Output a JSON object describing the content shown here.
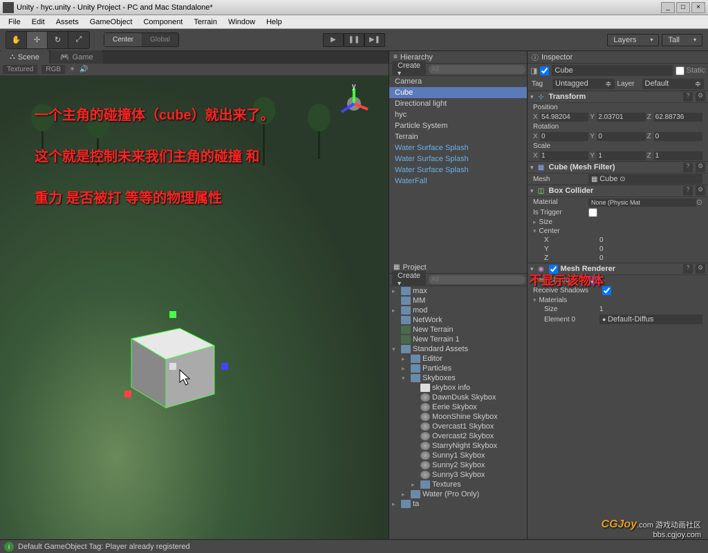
{
  "window": {
    "title": "Unity - hyc.unity - Unity Project - PC and Mac Standalone*"
  },
  "menus": [
    "File",
    "Edit",
    "Assets",
    "GameObject",
    "Component",
    "Terrain",
    "Window",
    "Help"
  ],
  "toolbar": {
    "pivot_center": "Center",
    "pivot_global": "Global",
    "layers": "Layers",
    "layout": "Tall"
  },
  "scene": {
    "tab_scene": "Scene",
    "tab_game": "Game",
    "shading": "Textured",
    "render": "RGB",
    "overlay1": "一个主角的碰撞体（cube）就出来了。",
    "overlay2": "这个就是控制未来我们主角的碰撞 和",
    "overlay3": "重力 是否被打 等等的物理属性"
  },
  "hierarchy": {
    "title": "Hierarchy",
    "create": "Create",
    "search_ph": "All",
    "items": [
      {
        "name": "Camera",
        "type": "normal"
      },
      {
        "name": "Cube",
        "type": "sel"
      },
      {
        "name": "Directional light",
        "type": "normal"
      },
      {
        "name": "hyc",
        "type": "normal"
      },
      {
        "name": "Particle System",
        "type": "normal"
      },
      {
        "name": "Terrain",
        "type": "normal"
      },
      {
        "name": "Water Surface Splash",
        "type": "prefab"
      },
      {
        "name": "Water Surface Splash",
        "type": "prefab"
      },
      {
        "name": "Water Surface Splash",
        "type": "prefab"
      },
      {
        "name": "WaterFall",
        "type": "prefab"
      }
    ]
  },
  "project": {
    "title": "Project",
    "create": "Create",
    "search_ph": "All",
    "tree": [
      {
        "indent": 0,
        "arr": "▸",
        "icon": "folder",
        "name": "max"
      },
      {
        "indent": 0,
        "arr": "",
        "icon": "folder",
        "name": "MM"
      },
      {
        "indent": 0,
        "arr": "▸",
        "icon": "folder",
        "name": "mod"
      },
      {
        "indent": 0,
        "arr": "",
        "icon": "folder",
        "name": "NetWork"
      },
      {
        "indent": 0,
        "arr": "",
        "icon": "terrain",
        "name": "New Terrain"
      },
      {
        "indent": 0,
        "arr": "",
        "icon": "terrain",
        "name": "New Terrain 1"
      },
      {
        "indent": 0,
        "arr": "▾",
        "icon": "folder",
        "name": "Standard Assets"
      },
      {
        "indent": 1,
        "arr": "▸",
        "icon": "folder",
        "name": "Editor"
      },
      {
        "indent": 1,
        "arr": "▸",
        "icon": "folder",
        "name": "Particles"
      },
      {
        "indent": 1,
        "arr": "▾",
        "icon": "folder",
        "name": "Skyboxes"
      },
      {
        "indent": 2,
        "arr": "",
        "icon": "doc",
        "name": "skybox info"
      },
      {
        "indent": 2,
        "arr": "",
        "icon": "skybox",
        "name": "DawnDusk Skybox"
      },
      {
        "indent": 2,
        "arr": "",
        "icon": "skybox",
        "name": "Eerie Skybox"
      },
      {
        "indent": 2,
        "arr": "",
        "icon": "skybox",
        "name": "MoonShine Skybox"
      },
      {
        "indent": 2,
        "arr": "",
        "icon": "skybox",
        "name": "Overcast1 Skybox"
      },
      {
        "indent": 2,
        "arr": "",
        "icon": "skybox",
        "name": "Overcast2 Skybox"
      },
      {
        "indent": 2,
        "arr": "",
        "icon": "skybox",
        "name": "StarryNight Skybox"
      },
      {
        "indent": 2,
        "arr": "",
        "icon": "skybox",
        "name": "Sunny1 Skybox"
      },
      {
        "indent": 2,
        "arr": "",
        "icon": "skybox",
        "name": "Sunny2 Skybox"
      },
      {
        "indent": 2,
        "arr": "",
        "icon": "skybox",
        "name": "Sunny3 Skybox"
      },
      {
        "indent": 2,
        "arr": "▸",
        "icon": "folder",
        "name": "Textures"
      },
      {
        "indent": 1,
        "arr": "▸",
        "icon": "folder",
        "name": "Water (Pro Only)"
      },
      {
        "indent": 0,
        "arr": "▸",
        "icon": "folder",
        "name": "ta"
      }
    ]
  },
  "inspector": {
    "title": "Inspector",
    "name": "Cube",
    "static": "Static",
    "tag_label": "Tag",
    "tag": "Untagged",
    "layer_label": "Layer",
    "layer": "Default",
    "transform": {
      "title": "Transform",
      "position_label": "Position",
      "pos": {
        "x": "54.98204",
        "y": "2.03701",
        "z": "62.88736"
      },
      "rotation_label": "Rotation",
      "rot": {
        "x": "0",
        "y": "0",
        "z": "0"
      },
      "scale_label": "Scale",
      "scale": {
        "x": "1",
        "y": "1",
        "z": "1"
      }
    },
    "meshfilter": {
      "title": "Cube (Mesh Filter)",
      "mesh_label": "Mesh",
      "mesh_value": "Cube"
    },
    "boxcollider": {
      "title": "Box Collider",
      "material_label": "Material",
      "material_value": "None (Physic Mat",
      "istrigger_label": "Is Trigger",
      "size_label": "Size",
      "center_label": "Center",
      "center": {
        "x": "0",
        "y": "0",
        "z": "0"
      }
    },
    "meshrenderer": {
      "title": "Mesh Renderer",
      "cast_label": "Cast Shadows",
      "recv_label": "Receive Shadows",
      "materials_label": "Materials",
      "size_label": "Size",
      "size_value": "1",
      "element_label": "Element 0",
      "element_value": "Default-Diffus",
      "overlay": "不显示该物体"
    }
  },
  "status": "Default GameObject Tag: Player already registered",
  "watermark": {
    "logo": "CGJoy",
    "sub": ".com 游戏动画社区",
    "url": "bbs.cgjoy.com"
  }
}
